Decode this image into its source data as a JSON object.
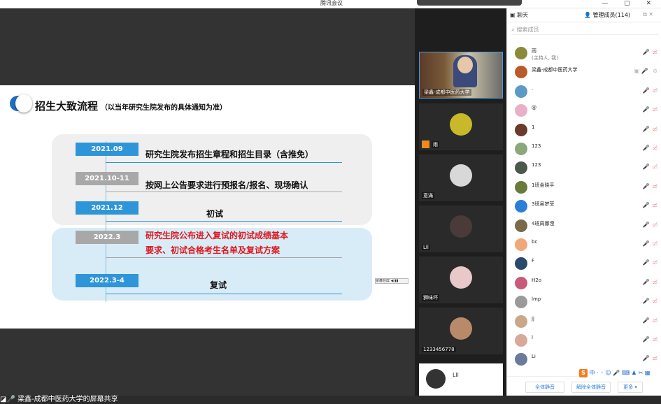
{
  "app": {
    "title": "腾讯会议",
    "window_controls": "— ▢ ✕"
  },
  "share": {
    "label": "梁鑫-成都中医药大学的屏幕共享",
    "mini_label": "梁鑫在屏 ◀ ▮▮"
  },
  "slide": {
    "title": "招生大致流程",
    "subtitle": "（以当年研究生院发布的具体通知为准）",
    "steps": [
      {
        "date": "2021.09",
        "text": "研究生院发布招生章程和招生目录（含推免）",
        "style": "blue"
      },
      {
        "date": "2021.10-11",
        "text": "按网上公告要求进行预报名/报名、现场确认",
        "style": "gray"
      },
      {
        "date": "2021.12",
        "text": "初试",
        "style": "blue"
      },
      {
        "date": "2022.3",
        "text1": "研究生院公布进入复试的初试成绩基本",
        "text2": "要求、初试合格考生名单及复试方案",
        "style": "gray"
      },
      {
        "date": "2022.3-4",
        "text": "复试",
        "style": "blue"
      }
    ]
  },
  "videos": [
    {
      "name": "梁鑫-成都中医药大学",
      "live": true
    },
    {
      "name": "雨"
    },
    {
      "name": "意滿"
    },
    {
      "name": "Lll"
    },
    {
      "name": "狮味坏"
    },
    {
      "name": "1233456778"
    }
  ],
  "self_tile": {
    "name": "Lll"
  },
  "panel": {
    "tabs": {
      "chat": "聊天",
      "members": "管理成员(114)"
    },
    "search_placeholder": "搜索成员",
    "participants": [
      {
        "name": "雨",
        "sub": "(主持人, 我)",
        "color": "#8a8a3a"
      },
      {
        "name": "梁鑫-成都中医药大学",
        "color": "#b85a2a",
        "speaking": true
      },
      {
        "name": ".",
        "color": "#5a9ac8"
      },
      {
        "name": "@",
        "color": "#e8b0c8"
      },
      {
        "name": "1",
        "color": "#6a3a2a"
      },
      {
        "name": "123",
        "color": "#8aa87a"
      },
      {
        "name": "123",
        "color": "#4a5a4a"
      },
      {
        "name": "1班金晓平",
        "color": "#6a7a3a"
      },
      {
        "name": "3班吴梦菲",
        "color": "#2a7ed8",
        "badge": "梦菲"
      },
      {
        "name": "4班周娜滢",
        "color": "#7a6a4a"
      },
      {
        "name": "bc",
        "color": "#f0a878"
      },
      {
        "name": "F",
        "color": "#2a4a6a"
      },
      {
        "name": "H2o",
        "color": "#c85a7a"
      },
      {
        "name": "lmp",
        "color": "#9a9a9a"
      },
      {
        "name": "jj",
        "color": "#c8a888"
      },
      {
        "name": "l",
        "color": "#d8a898"
      },
      {
        "name": "Li",
        "color": "#6a7a9a"
      }
    ],
    "buttons": {
      "mute_all": "全体静音",
      "unmute_all": "解除全体静音",
      "more": "更多 ▾"
    }
  },
  "ime": {
    "logo": "S",
    "text": "中 · ◦ ☺ 🎤 ⌨ ♟ ✂ ▦"
  }
}
